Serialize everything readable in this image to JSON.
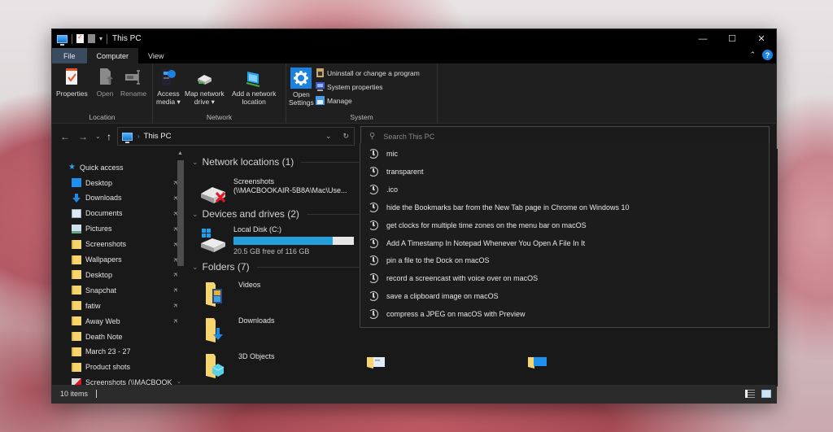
{
  "window": {
    "title": "This PC",
    "controls": {
      "minimize": "—",
      "maximize": "☐",
      "close": "✕"
    }
  },
  "tabs": [
    {
      "label": "File"
    },
    {
      "label": "Computer"
    },
    {
      "label": "View"
    }
  ],
  "ribbon": {
    "groups": [
      {
        "label": "Location",
        "buttons": [
          {
            "label": "Properties",
            "icon": "properties-icon"
          },
          {
            "label": "Open",
            "icon": "open-icon"
          },
          {
            "label": "Rename",
            "icon": "rename-icon"
          }
        ]
      },
      {
        "label": "Network",
        "buttons": [
          {
            "label": "Access media ▾",
            "line1": "Access",
            "line2": "media ▾",
            "icon": "access-media-icon"
          },
          {
            "label": "Map network drive ▾",
            "line1": "Map network",
            "line2": "drive ▾",
            "icon": "map-network-drive-icon"
          },
          {
            "label": "Add a network location",
            "line1": "Add a network",
            "line2": "location",
            "icon": "add-network-location-icon"
          }
        ]
      },
      {
        "label": "System",
        "buttons": [
          {
            "label": "Open Settings",
            "line1": "Open",
            "line2": "Settings",
            "icon": "settings-gear-icon"
          }
        ],
        "small_buttons": [
          {
            "label": "Uninstall or change a program",
            "icon": "uninstall-icon"
          },
          {
            "label": "System properties",
            "icon": "system-properties-icon"
          },
          {
            "label": "Manage",
            "icon": "manage-icon"
          }
        ]
      }
    ]
  },
  "navigation": {
    "back": "←",
    "forward": "→",
    "recent": "⌄",
    "up": "↑",
    "address": "This PC",
    "refresh": "↻"
  },
  "search": {
    "placeholder": "Search This PC",
    "value": "",
    "suggestions": [
      "mic",
      "transparent",
      ".ico",
      "hide the Bookmarks bar from the New Tab page in Chrome on Windows 10",
      "get clocks for multiple time zones on the menu bar on macOS",
      "Add A Timestamp In Notepad Whenever You Open A File In It",
      "pin a file to the Dock on macOS",
      "record a screencast with voice over on macOS",
      "save a clipboard image on macOS",
      "compress a JPEG on macOS with Preview"
    ]
  },
  "sidebar": {
    "quick_access": "Quick access",
    "items": [
      {
        "label": "Desktop",
        "icon": "desktop-icon",
        "pinned": true
      },
      {
        "label": "Downloads",
        "icon": "downloads-icon",
        "pinned": true
      },
      {
        "label": "Documents",
        "icon": "documents-icon",
        "pinned": true
      },
      {
        "label": "Pictures",
        "icon": "pictures-icon",
        "pinned": true
      },
      {
        "label": "Screenshots",
        "icon": "folder-icon",
        "pinned": true
      },
      {
        "label": "Wallpapers",
        "icon": "folder-icon",
        "pinned": true
      },
      {
        "label": "Desktop",
        "icon": "folder-icon",
        "pinned": true
      },
      {
        "label": "Snapchat",
        "icon": "folder-icon",
        "pinned": true
      },
      {
        "label": "fatiw",
        "icon": "folder-icon",
        "pinned": true
      },
      {
        "label": "Away Web",
        "icon": "folder-icon",
        "pinned": true
      },
      {
        "label": "Death Note",
        "icon": "folder-icon",
        "pinned": false
      },
      {
        "label": "March 23 - 27",
        "icon": "folder-icon",
        "pinned": false
      },
      {
        "label": "Product shots",
        "icon": "folder-icon",
        "pinned": false
      },
      {
        "label": "Screenshots (\\\\MACBOOK",
        "icon": "disconnected-network-drive-icon",
        "pinned": false
      }
    ],
    "pin_glyph": "📌"
  },
  "content": {
    "sections": [
      {
        "label": "Network locations (1)"
      },
      {
        "label": "Devices and drives (2)"
      },
      {
        "label": "Folders (7)"
      }
    ],
    "network_locations": [
      {
        "name": "Screenshots",
        "path": "(\\\\MACBOOKAIR-5B8A\\Mac\\Use..."
      }
    ],
    "drives": [
      {
        "name": "Local Disk (C:)",
        "free": "20.5 GB free of 116 GB",
        "used_fraction": 0.823
      }
    ],
    "folders": [
      {
        "name": "Videos"
      },
      {
        "name": "Downloads"
      },
      {
        "name": "3D Objects"
      }
    ]
  },
  "status": {
    "items_count": "10 items"
  },
  "colors": {
    "accent": "#26a0da",
    "file_tab": "#3a4b5f",
    "help": "#1b82e0"
  }
}
